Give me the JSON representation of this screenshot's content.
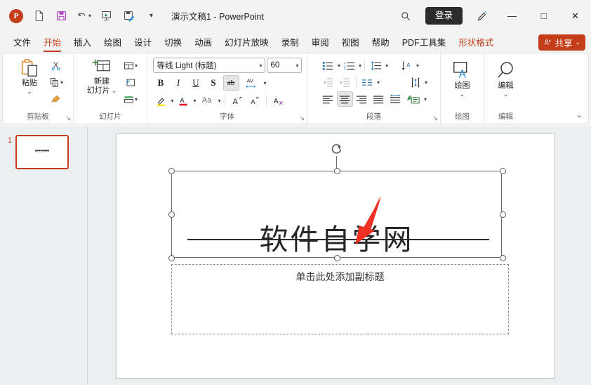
{
  "titlebar": {
    "app_badge": "P",
    "document_title": "演示文稿1  -  PowerPoint",
    "quick_access": [
      {
        "name": "new-file-icon",
        "label": "新建"
      },
      {
        "name": "save-icon",
        "label": "保存"
      },
      {
        "name": "undo-icon",
        "label": "撤消"
      },
      {
        "name": "start-slideshow-icon",
        "label": "从头开始"
      },
      {
        "name": "save-as-icon",
        "label": "另存为"
      },
      {
        "name": "customize-qat-icon",
        "label": "自定义快速访问工具栏"
      }
    ],
    "search_icon": "search-icon",
    "signin_label": "登录",
    "designer_icon": "pen-designer-icon",
    "window_controls": {
      "minimize": "—",
      "maximize": "□",
      "close": "✕"
    }
  },
  "tabs": [
    {
      "label": "文件",
      "active": false,
      "contextual": false
    },
    {
      "label": "开始",
      "active": true,
      "contextual": false
    },
    {
      "label": "插入",
      "active": false,
      "contextual": false
    },
    {
      "label": "绘图",
      "active": false,
      "contextual": false
    },
    {
      "label": "设计",
      "active": false,
      "contextual": false
    },
    {
      "label": "切换",
      "active": false,
      "contextual": false
    },
    {
      "label": "动画",
      "active": false,
      "contextual": false
    },
    {
      "label": "幻灯片放映",
      "active": false,
      "contextual": false
    },
    {
      "label": "录制",
      "active": false,
      "contextual": false
    },
    {
      "label": "审阅",
      "active": false,
      "contextual": false
    },
    {
      "label": "视图",
      "active": false,
      "contextual": false
    },
    {
      "label": "帮助",
      "active": false,
      "contextual": false
    },
    {
      "label": "PDF工具集",
      "active": false,
      "contextual": false
    },
    {
      "label": "形状格式",
      "active": false,
      "contextual": true
    }
  ],
  "share": {
    "label": "共享",
    "icon": "share-person-icon",
    "caret": "⌄",
    "color": "#c43e1c"
  },
  "ribbon": {
    "groups": {
      "clipboard": {
        "label": "剪贴板",
        "paste_label": "粘贴",
        "paste_caret": "⌄",
        "cut_icon": "scissors-icon",
        "copy_icon": "copy-icon",
        "format_painter_icon": "format-painter-icon",
        "dialog_launcher": "↘"
      },
      "slides": {
        "label": "幻灯片",
        "new_slide_label": "新建\n幻灯片",
        "new_slide_line1": "新建",
        "new_slide_line2": "幻灯片",
        "caret": "⌄",
        "layout_icon": "slide-layout-icon",
        "reset_icon": "slide-reset-icon",
        "section_icon": "slide-section-icon"
      },
      "font": {
        "label": "字体",
        "font_name": "等线 Light (标题)",
        "font_size": "60",
        "bold": "B",
        "italic": "I",
        "underline": "U",
        "shadow": "S",
        "strikethrough": "ab",
        "strikethrough_active": true,
        "char_spacing": "AV",
        "text_highlight_icon": "text-highlight-icon",
        "font_color_icon": "font-color-icon",
        "change_case": "Aa",
        "grow_font": "A",
        "shrink_font": "A",
        "clear_format_icon": "clear-formatting-icon",
        "dialog_launcher": "↘"
      },
      "paragraph": {
        "label": "段落",
        "bullets_icon": "bullet-list-icon",
        "numbering_icon": "numbered-list-icon",
        "line_spacing_icon": "line-spacing-icon",
        "text_direction_icon": "text-direction-icon",
        "decrease_indent_icon": "decrease-indent-icon",
        "increase_indent_icon": "increase-indent-icon",
        "columns_icon": "columns-icon",
        "align_text_icon": "align-text-vertical-icon",
        "align_left_icon": "align-left-icon",
        "align_center_icon": "align-center-icon",
        "align_right_icon": "align-right-icon",
        "align_justify_icon": "align-justify-icon",
        "distribute_icon": "distribute-text-icon",
        "smartart_icon": "convert-smartart-icon",
        "align_center_active": true,
        "dialog_launcher": "↘"
      },
      "drawing": {
        "label": "绘图",
        "button_label": "绘图",
        "caret": "⌄",
        "icon": "shapes-textbox-icon"
      },
      "editing": {
        "label": "编辑",
        "button_label": "编辑",
        "caret": "⌄",
        "icon": "find-magnifier-icon"
      }
    },
    "collapse_caret": "⌄"
  },
  "thumbnails": [
    {
      "number": "1",
      "selected": true,
      "preview_text": "软件自学网"
    }
  ],
  "slide": {
    "title_placeholder": {
      "text": "软件自学网",
      "strikethrough": true,
      "selected": true,
      "rotation_handle_icon": "rotate-handle-icon"
    },
    "subtitle_placeholder": {
      "text": "单击此处添加副标题",
      "selected": false
    },
    "annotation": {
      "type": "red-arrow",
      "color": "#ef3124",
      "points_to": "title-strikethrough"
    }
  }
}
